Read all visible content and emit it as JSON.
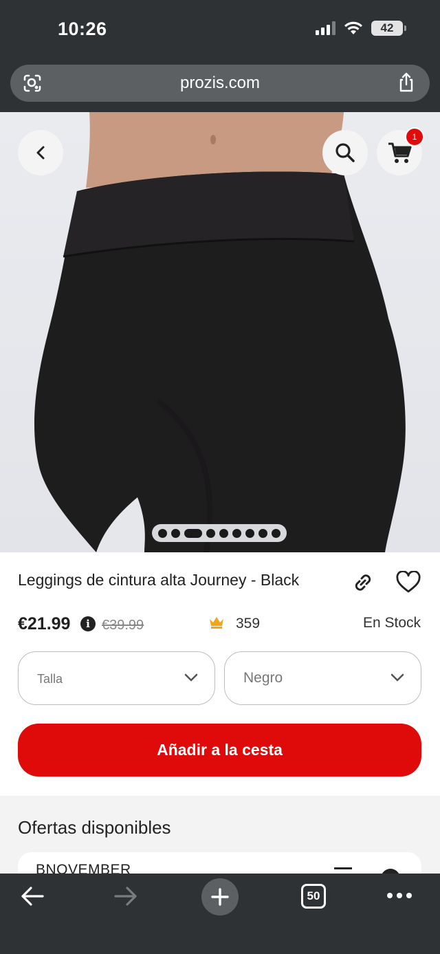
{
  "status_bar": {
    "time": "10:26",
    "battery": "42"
  },
  "browser": {
    "url": "prozis.com",
    "tab_count": "50"
  },
  "product_header": {
    "cart_count": "1"
  },
  "product": {
    "title": "Leggings de cintura alta Journey - Black",
    "price": "€21.99",
    "info_glyph": "i",
    "old_price": "€39.99",
    "points": "359",
    "stock": "En Stock",
    "size_placeholder": "Talla",
    "color_selected": "Negro",
    "add_to_cart": "Añadir a la cesta",
    "image_count": 9,
    "active_image_index": 2
  },
  "offers": {
    "title": "Ofertas disponibles",
    "items": [
      {
        "code": "BNOVEMBER"
      }
    ]
  },
  "colors": {
    "accent": "#df0a0a",
    "chrome": "#2f3234",
    "badge": "#e00b0b"
  },
  "icons": [
    "lens-icon",
    "share-icon",
    "back-icon",
    "search-icon",
    "cart-icon",
    "link-icon",
    "heart-icon",
    "info-icon",
    "crown-icon",
    "chevron-down-icon",
    "copy-icon",
    "arrow-left-icon",
    "arrow-right-icon",
    "plus-icon",
    "tabs-icon",
    "more-icon"
  ]
}
